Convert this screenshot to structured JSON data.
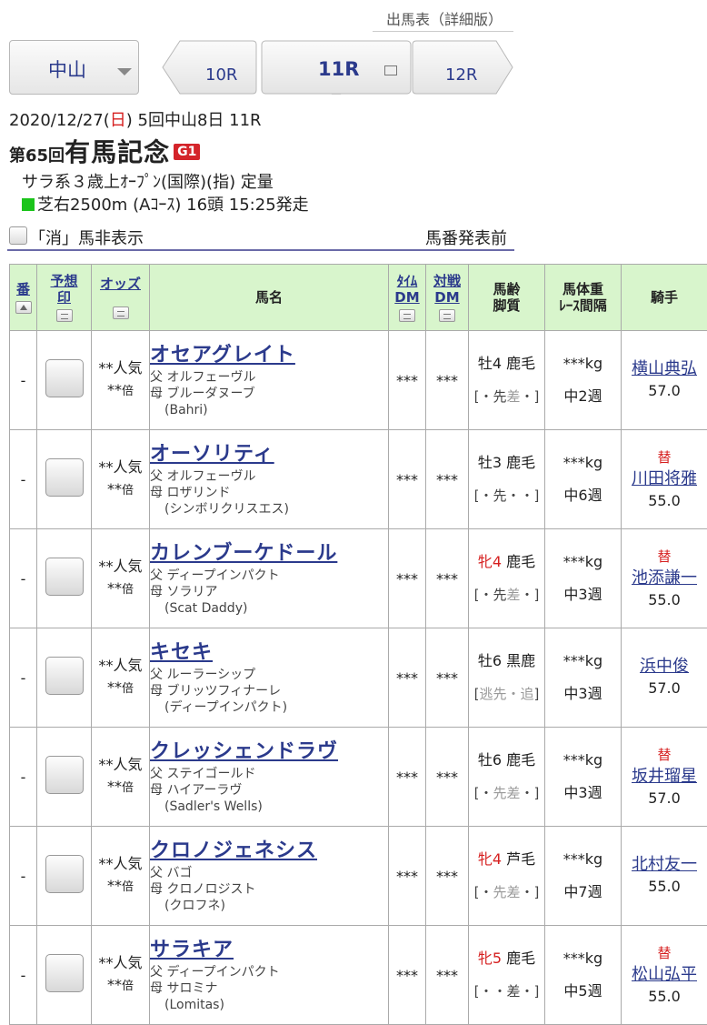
{
  "header": {
    "link": "出馬表（詳細版）"
  },
  "nav": {
    "venue": "中山",
    "prev": "10R",
    "current": "11R",
    "next": "12R"
  },
  "race": {
    "date": "2020/12/27(",
    "weekday": "日",
    "date_rest": ") 5回中山8日 11R",
    "number": "第65回",
    "name": "有馬記念",
    "grade": "G1",
    "conditions": "サラ系３歳上ｵｰﾌﾟﾝ(国際)(指) 定量",
    "course": "芝右2500m (Aｺｰｽ) 16頭 15:25発走"
  },
  "options": {
    "hide_label": "「消」馬非表示",
    "status": "馬番発表前"
  },
  "columns": {
    "no": "番",
    "mark_1": "予想",
    "mark_2": "印",
    "odds": "オッズ",
    "name": "馬名",
    "time_1": "ﾀｲﾑ",
    "time_2": "DM",
    "vs_1": "対戦",
    "vs_2": "DM",
    "age_1": "馬齢",
    "age_2": "脚質",
    "weight_1": "馬体重",
    "weight_2": "ﾚｰｽ間隔",
    "jockey": "騎手"
  },
  "colors": {
    "link": "#2b3a8c",
    "header_bg": "#d8f5cc",
    "red": "#d62020",
    "turf": "#1bc41b"
  },
  "rows": [
    {
      "no": "-",
      "pop": "**人気",
      "odds_v": "**",
      "odds_u": "倍",
      "name": "オセアグレイト",
      "sire": "父 オルフェーヴル",
      "dam": "母 ブルーダヌーブ",
      "bms": "(Bahri)",
      "time": "***",
      "vs": "***",
      "sex": "牡4",
      "sex_female": false,
      "coat": "鹿毛",
      "style_l": "[・先",
      "style_m": "差",
      "style_r": "・]",
      "weight": "***kg",
      "interval": "中2週",
      "sub": "",
      "jockey": "横山典弘",
      "kg": "57.0"
    },
    {
      "no": "-",
      "pop": "**人気",
      "odds_v": "**",
      "odds_u": "倍",
      "name": "オーソリティ",
      "sire": "父 オルフェーヴル",
      "dam": "母 ロザリンド",
      "bms": "(シンボリクリスエス)",
      "time": "***",
      "vs": "***",
      "sex": "牡3",
      "sex_female": false,
      "coat": "鹿毛",
      "style_l": "[・先・",
      "style_m": "",
      "style_r": "・]",
      "weight": "***kg",
      "interval": "中6週",
      "sub": "替",
      "jockey": "川田将雅",
      "kg": "55.0"
    },
    {
      "no": "-",
      "pop": "**人気",
      "odds_v": "**",
      "odds_u": "倍",
      "name": "カレンブーケドール",
      "sire": "父 ディープインパクト",
      "dam": "母 ソラリア",
      "bms": "(Scat Daddy)",
      "time": "***",
      "vs": "***",
      "sex": "牝4",
      "sex_female": true,
      "coat": "鹿毛",
      "style_l": "[・先",
      "style_m": "差",
      "style_r": "・]",
      "weight": "***kg",
      "interval": "中3週",
      "sub": "替",
      "jockey": "池添謙一",
      "kg": "55.0"
    },
    {
      "no": "-",
      "pop": "**人気",
      "odds_v": "**",
      "odds_u": "倍",
      "name": "キセキ",
      "sire": "父 ルーラーシップ",
      "dam": "母 ブリッツフィナーレ",
      "bms": "(ディープインパクト)",
      "time": "***",
      "vs": "***",
      "sex": "牡6",
      "sex_female": false,
      "coat": "黒鹿",
      "style_l": "[",
      "style_m": "逃先・追",
      "style_r": "]",
      "weight": "***kg",
      "interval": "中3週",
      "sub": "",
      "jockey": "浜中俊",
      "kg": "57.0"
    },
    {
      "no": "-",
      "pop": "**人気",
      "odds_v": "**",
      "odds_u": "倍",
      "name": "クレッシェンドラヴ",
      "sire": "父 ステイゴールド",
      "dam": "母 ハイアーラヴ",
      "bms": "(Sadler's Wells)",
      "time": "***",
      "vs": "***",
      "sex": "牡6",
      "sex_female": false,
      "coat": "鹿毛",
      "style_l": "[・",
      "style_m": "先差",
      "style_r": "・]",
      "weight": "***kg",
      "interval": "中3週",
      "sub": "替",
      "jockey": "坂井瑠星",
      "kg": "57.0"
    },
    {
      "no": "-",
      "pop": "**人気",
      "odds_v": "**",
      "odds_u": "倍",
      "name": "クロノジェネシス",
      "sire": "父 バゴ",
      "dam": "母 クロノロジスト",
      "bms": "(クロフネ)",
      "time": "***",
      "vs": "***",
      "sex": "牝4",
      "sex_female": true,
      "coat": "芦毛",
      "style_l": "[・",
      "style_m": "先差",
      "style_r": "・]",
      "weight": "***kg",
      "interval": "中7週",
      "sub": "",
      "jockey": "北村友一",
      "kg": "55.0"
    },
    {
      "no": "-",
      "pop": "**人気",
      "odds_v": "**",
      "odds_u": "倍",
      "name": "サラキア",
      "sire": "父 ディープインパクト",
      "dam": "母 サロミナ",
      "bms": "(Lomitas)",
      "time": "***",
      "vs": "***",
      "sex": "牝5",
      "sex_female": true,
      "coat": "鹿毛",
      "style_l": "[・・差・]",
      "style_m": "",
      "style_r": "",
      "weight": "***kg",
      "interval": "中5週",
      "sub": "替",
      "jockey": "松山弘平",
      "kg": "55.0"
    }
  ]
}
